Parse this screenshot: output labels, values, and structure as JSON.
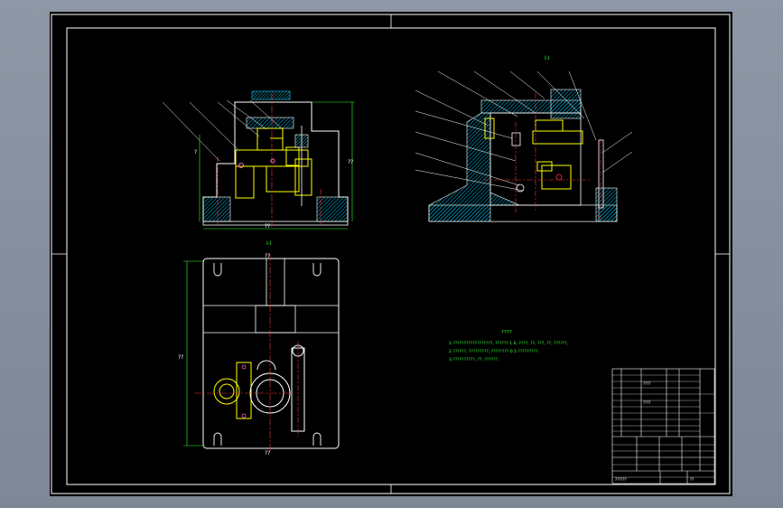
{
  "drawing": {
    "section_view_label": "I-I",
    "top_view_label": "I-I",
    "left_dim_label": "?",
    "bottom_dim_label": "??",
    "right_dim_label": "??",
    "plan_left_dim_label": "??",
    "plan_bottom_label": "??",
    "plan_top_label": "??"
  },
  "notes": {
    "title": "????",
    "lines": [
      "1.??????????????????, ?????? 1.6, ????, ??, ???, ??, ??????,",
      "2.??????, ?????????, ???????? 0.5 ?????????.",
      "3.??????????, ??, ??????."
    ]
  },
  "title_block": {
    "school_label": "????",
    "drawing_name": "????",
    "footer_left": "??????",
    "footer_right": "??"
  },
  "colors": {
    "background": "#000000",
    "outline": "#ffffff",
    "centerline": "#ff3333",
    "hatch": "#00a0c8",
    "part": "#ffff00",
    "dimension": "#33ff33"
  }
}
